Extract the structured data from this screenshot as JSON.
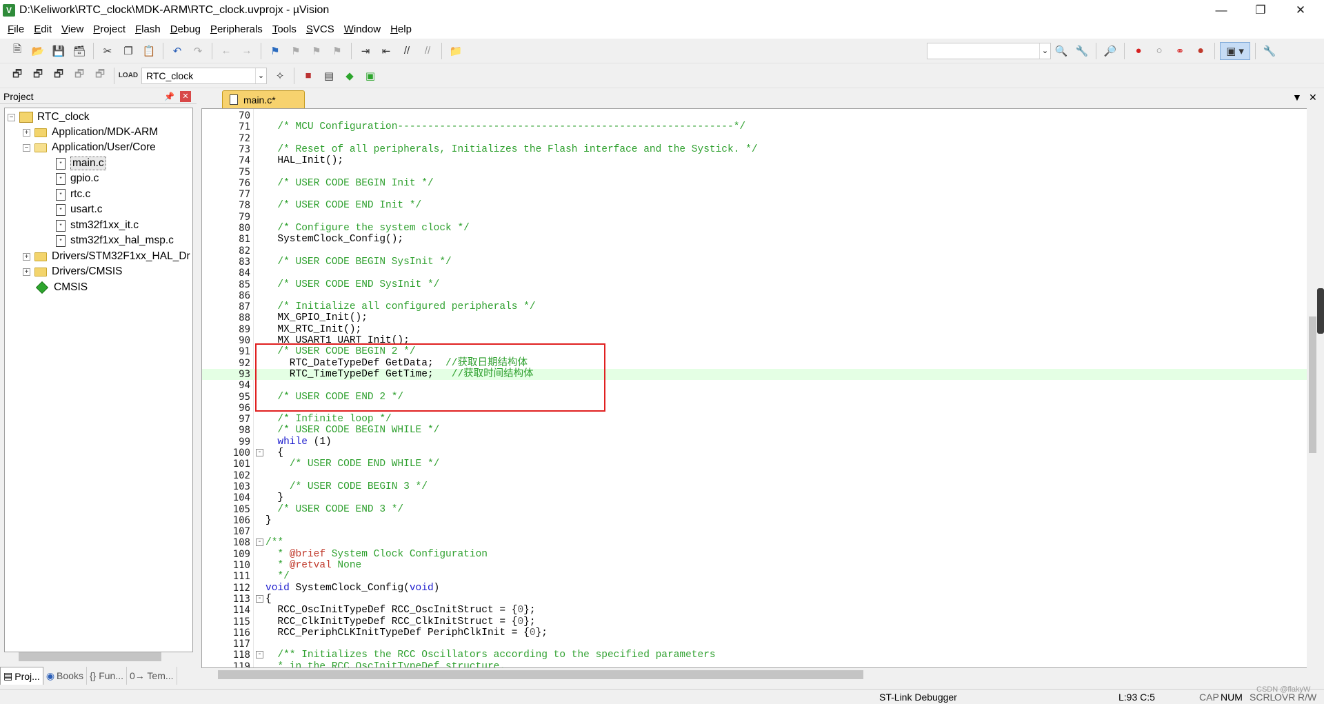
{
  "window": {
    "title": "D:\\Keliwork\\RTC_clock\\MDK-ARM\\RTC_clock.uvprojx - µVision"
  },
  "menu": [
    {
      "u": "F",
      "rest": "ile"
    },
    {
      "u": "E",
      "rest": "dit"
    },
    {
      "u": "V",
      "rest": "iew"
    },
    {
      "u": "P",
      "rest": "roject"
    },
    {
      "u": "F",
      "rest": "lash",
      "pre": ""
    },
    {
      "u": "D",
      "rest": "ebug"
    },
    {
      "u": "P",
      "rest": "eripherals"
    },
    {
      "u": "T",
      "rest": "ools"
    },
    {
      "u": "S",
      "rest": "VCS"
    },
    {
      "u": "W",
      "rest": "indow"
    },
    {
      "u": "H",
      "rest": "elp"
    }
  ],
  "toolbar": {
    "target_select": "RTC_clock"
  },
  "project_panel": {
    "title": "Project",
    "tree": {
      "root": "RTC_clock",
      "group_app_mdk": "Application/MDK-ARM",
      "group_app_user": "Application/User/Core",
      "files": [
        "main.c",
        "gpio.c",
        "rtc.c",
        "usart.c",
        "stm32f1xx_it.c",
        "stm32f1xx_hal_msp.c"
      ],
      "group_drivers_hal": "Drivers/STM32F1xx_HAL_Dr",
      "group_drivers_cmsis": "Drivers/CMSIS",
      "cmsis": "CMSIS"
    },
    "tabs": [
      "Proj...",
      "Books",
      "{} Fun...",
      "0→ Tem..."
    ]
  },
  "editor": {
    "tab_label": "main.c*",
    "lines": [
      {
        "n": "70",
        "html": ""
      },
      {
        "n": "71",
        "html": "  <span class='c-cm'>/* MCU Configuration--------------------------------------------------------*/</span>"
      },
      {
        "n": "72",
        "html": ""
      },
      {
        "n": "73",
        "html": "  <span class='c-cm'>/* Reset of all peripherals, Initializes the Flash interface and the Systick. */</span>"
      },
      {
        "n": "74",
        "html": "  HAL_Init();"
      },
      {
        "n": "75",
        "html": ""
      },
      {
        "n": "76",
        "html": "  <span class='c-cm'>/* USER CODE BEGIN Init */</span>"
      },
      {
        "n": "77",
        "html": ""
      },
      {
        "n": "78",
        "html": "  <span class='c-cm'>/* USER CODE END Init */</span>"
      },
      {
        "n": "79",
        "html": ""
      },
      {
        "n": "80",
        "html": "  <span class='c-cm'>/* Configure the system clock */</span>"
      },
      {
        "n": "81",
        "html": "  SystemClock_Config();"
      },
      {
        "n": "82",
        "html": ""
      },
      {
        "n": "83",
        "html": "  <span class='c-cm'>/* USER CODE BEGIN SysInit */</span>"
      },
      {
        "n": "84",
        "html": ""
      },
      {
        "n": "85",
        "html": "  <span class='c-cm'>/* USER CODE END SysInit */</span>"
      },
      {
        "n": "86",
        "html": ""
      },
      {
        "n": "87",
        "html": "  <span class='c-cm'>/* Initialize all configured peripherals */</span>"
      },
      {
        "n": "88",
        "html": "  MX_GPIO_Init();"
      },
      {
        "n": "89",
        "html": "  MX_RTC_Init();"
      },
      {
        "n": "90",
        "html": "  MX_USART1_UART_Init();"
      },
      {
        "n": "91",
        "html": "  <span class='c-cm'>/* USER CODE BEGIN 2 */</span>"
      },
      {
        "n": "92",
        "html": "    RTC_DateTypeDef GetData;  <span class='c-cm'>//获取日期结构体</span>"
      },
      {
        "n": "93",
        "html": "    RTC_TimeTypeDef GetTime;   <span class='c-cm'>//获取时间结构体</span>",
        "cur": true
      },
      {
        "n": "94",
        "html": ""
      },
      {
        "n": "95",
        "html": "  <span class='c-cm'>/* USER CODE END 2 */</span>"
      },
      {
        "n": "96",
        "html": ""
      },
      {
        "n": "97",
        "html": "  <span class='c-cm'>/* Infinite loop */</span>"
      },
      {
        "n": "98",
        "html": "  <span class='c-cm'>/* USER CODE BEGIN WHILE */</span>"
      },
      {
        "n": "99",
        "html": "  <span class='c-kw'>while</span> (1)"
      },
      {
        "n": "100",
        "html": "  {",
        "fold": "-"
      },
      {
        "n": "101",
        "html": "    <span class='c-cm'>/* USER CODE END WHILE */</span>"
      },
      {
        "n": "102",
        "html": ""
      },
      {
        "n": "103",
        "html": "    <span class='c-cm'>/* USER CODE BEGIN 3 */</span>"
      },
      {
        "n": "104",
        "html": "  }"
      },
      {
        "n": "105",
        "html": "  <span class='c-cm'>/* USER CODE END 3 */</span>"
      },
      {
        "n": "106",
        "html": "}"
      },
      {
        "n": "107",
        "html": ""
      },
      {
        "n": "108",
        "html": "<span class='c-cm'>/**</span>",
        "fold": "-"
      },
      {
        "n": "109",
        "html": "<span class='c-cm'>  * </span><span class='c-doc'>@brief</span><span class='c-cm'> System Clock Configuration</span>"
      },
      {
        "n": "110",
        "html": "<span class='c-cm'>  * </span><span class='c-doc'>@retval</span><span class='c-cm'> None</span>"
      },
      {
        "n": "111",
        "html": "<span class='c-cm'>  */</span>"
      },
      {
        "n": "112",
        "html": "<span class='c-kw'>void</span> SystemClock_Config(<span class='c-kw'>void</span>)"
      },
      {
        "n": "113",
        "html": "{",
        "fold": "-"
      },
      {
        "n": "114",
        "html": "  RCC_OscInitTypeDef RCC_OscInitStruct = {<span class='c-nm'>0</span>};"
      },
      {
        "n": "115",
        "html": "  RCC_ClkInitTypeDef RCC_ClkInitStruct = {<span class='c-nm'>0</span>};"
      },
      {
        "n": "116",
        "html": "  RCC_PeriphCLKInitTypeDef PeriphClkInit = {<span class='c-nm'>0</span>};"
      },
      {
        "n": "117",
        "html": ""
      },
      {
        "n": "118",
        "html": "  <span class='c-cm'>/** Initializes the RCC Oscillators according to the specified parameters</span>",
        "fold": "-"
      },
      {
        "n": "119",
        "html": "  <span class='c-cm'>* in the RCC_OscInitTypeDef structure.</span>"
      }
    ]
  },
  "status": {
    "debugger": "ST-Link Debugger",
    "position": "L:93 C:5",
    "cap": "CAP",
    "num": "NUM",
    "scrl": "SCRL",
    "ovr": "OVR",
    "rw": "R/W",
    "watermark": "CSDN @flakyW"
  }
}
